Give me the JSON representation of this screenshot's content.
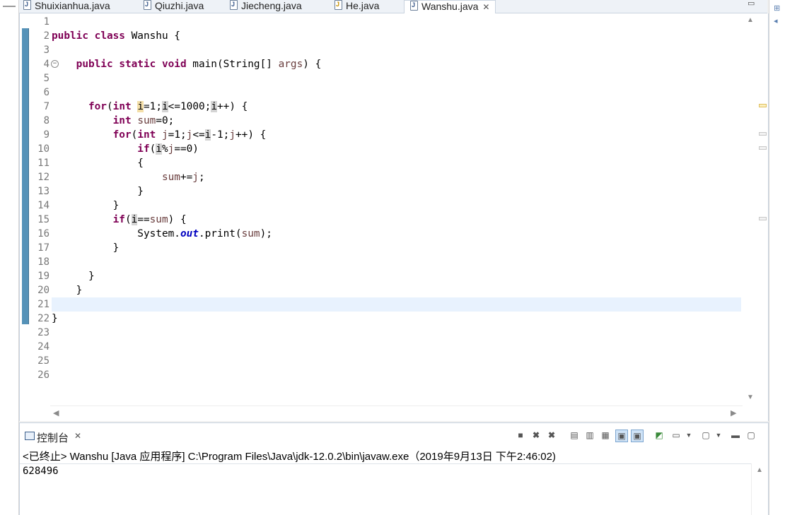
{
  "tabs": [
    {
      "label": "Shuixianhua.java",
      "icon": "java-file-icon"
    },
    {
      "label": "Qiuzhi.java",
      "icon": "java-file-icon"
    },
    {
      "label": "Jiecheng.java",
      "icon": "java-file-icon"
    },
    {
      "label": "He.java",
      "icon": "java-file-warning-icon"
    },
    {
      "label": "Wanshu.java",
      "icon": "java-file-icon",
      "active": true
    }
  ],
  "tab_close_glyph": "✕",
  "editor": {
    "line_numbers": [
      "1",
      "2",
      "3",
      "4",
      "5",
      "6",
      "7",
      "8",
      "9",
      "10",
      "11",
      "12",
      "13",
      "14",
      "15",
      "16",
      "17",
      "18",
      "19",
      "20",
      "21",
      "22",
      "23",
      "24",
      "25",
      "26"
    ],
    "current_line": 21
  },
  "console": {
    "title": "控制台",
    "close_glyph": "✕",
    "header": "<已终止> Wanshu [Java 应用程序] C:\\Program Files\\Java\\jdk-12.0.2\\bin\\javaw.exe（2019年9月13日 下午2:46:02)",
    "output": "628496"
  },
  "colors": {
    "keyword": "#7f0055",
    "variable": "#6a3e3e",
    "field": "#0000c0",
    "current_line_bg": "#e8f2fe",
    "gutter_change_bar": "#5592b8"
  }
}
